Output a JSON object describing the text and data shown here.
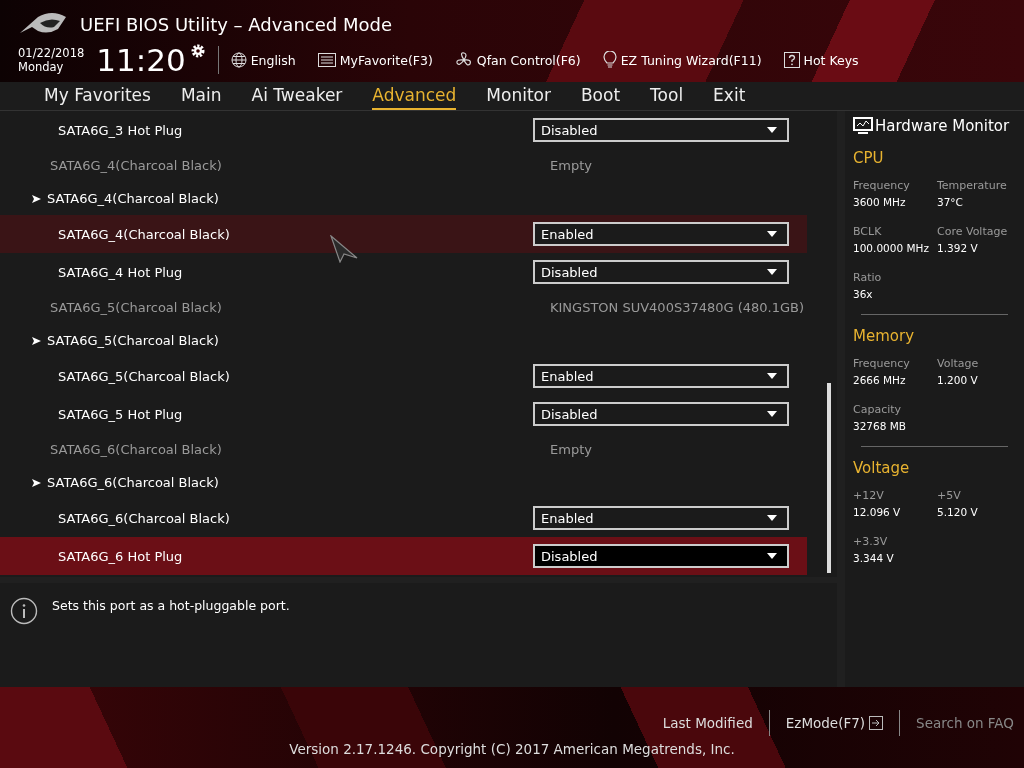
{
  "header": {
    "title": "UEFI BIOS Utility – Advanced Mode",
    "date": "01/22/2018",
    "day": "Monday",
    "time": "11:20",
    "tools": [
      {
        "label": "English"
      },
      {
        "label": "MyFavorite(F3)"
      },
      {
        "label": "Qfan Control(F6)"
      },
      {
        "label": "EZ Tuning Wizard(F11)"
      },
      {
        "label": "Hot Keys"
      }
    ]
  },
  "tabs": [
    {
      "label": "My Favorites",
      "selected": false
    },
    {
      "label": "Main",
      "selected": false
    },
    {
      "label": "Ai Tweaker",
      "selected": false
    },
    {
      "label": "Advanced",
      "selected": true
    },
    {
      "label": "Monitor",
      "selected": false
    },
    {
      "label": "Boot",
      "selected": false
    },
    {
      "label": "Tool",
      "selected": false
    },
    {
      "label": "Exit",
      "selected": false
    }
  ],
  "settings": [
    {
      "kind": "option",
      "label": "SATA6G_3 Hot Plug",
      "value": "Disabled",
      "selected": false,
      "hovered": false
    },
    {
      "kind": "info",
      "label": "SATA6G_4(Charcoal Black)",
      "value": "Empty"
    },
    {
      "kind": "submenu",
      "label": "SATA6G_4(Charcoal Black)"
    },
    {
      "kind": "option",
      "label": "SATA6G_4(Charcoal Black)",
      "value": "Enabled",
      "selected": false,
      "hovered": true
    },
    {
      "kind": "option",
      "label": "SATA6G_4 Hot Plug",
      "value": "Disabled",
      "selected": false,
      "hovered": false
    },
    {
      "kind": "info",
      "label": "SATA6G_5(Charcoal Black)",
      "value": "KINGSTON SUV400S37480G (480.1GB)"
    },
    {
      "kind": "submenu",
      "label": "SATA6G_5(Charcoal Black)"
    },
    {
      "kind": "option",
      "label": "SATA6G_5(Charcoal Black)",
      "value": "Enabled",
      "selected": false,
      "hovered": false
    },
    {
      "kind": "option",
      "label": "SATA6G_5 Hot Plug",
      "value": "Disabled",
      "selected": false,
      "hovered": false
    },
    {
      "kind": "info",
      "label": "SATA6G_6(Charcoal Black)",
      "value": "Empty"
    },
    {
      "kind": "submenu",
      "label": "SATA6G_6(Charcoal Black)"
    },
    {
      "kind": "option",
      "label": "SATA6G_6(Charcoal Black)",
      "value": "Enabled",
      "selected": false,
      "hovered": false
    },
    {
      "kind": "option",
      "label": "SATA6G_6 Hot Plug",
      "value": "Disabled",
      "selected": true,
      "hovered": false
    }
  ],
  "help": "Sets this port as a hot-pluggable port.",
  "hardware_monitor": {
    "title": "Hardware Monitor",
    "sections": [
      {
        "title": "CPU",
        "items": [
          {
            "label": "Frequency",
            "value": "3600 MHz"
          },
          {
            "label": "Temperature",
            "value": "37°C"
          },
          {
            "label": "BCLK",
            "value": "100.0000 MHz"
          },
          {
            "label": "Core Voltage",
            "value": "1.392 V"
          },
          {
            "label": "Ratio",
            "value": "36x"
          }
        ]
      },
      {
        "title": "Memory",
        "items": [
          {
            "label": "Frequency",
            "value": "2666 MHz"
          },
          {
            "label": "Voltage",
            "value": "1.200 V"
          },
          {
            "label": "Capacity",
            "value": "32768 MB"
          }
        ]
      },
      {
        "title": "Voltage",
        "items": [
          {
            "label": "+12V",
            "value": "12.096 V"
          },
          {
            "label": "+5V",
            "value": "5.120 V"
          },
          {
            "label": "+3.3V",
            "value": "3.344 V"
          }
        ]
      }
    ]
  },
  "footer": {
    "last_modified": "Last Modified",
    "ez_mode": "EzMode(F7)",
    "search": "Search on FAQ",
    "version": "Version 2.17.1246. Copyright (C) 2017 American Megatrends, Inc."
  }
}
